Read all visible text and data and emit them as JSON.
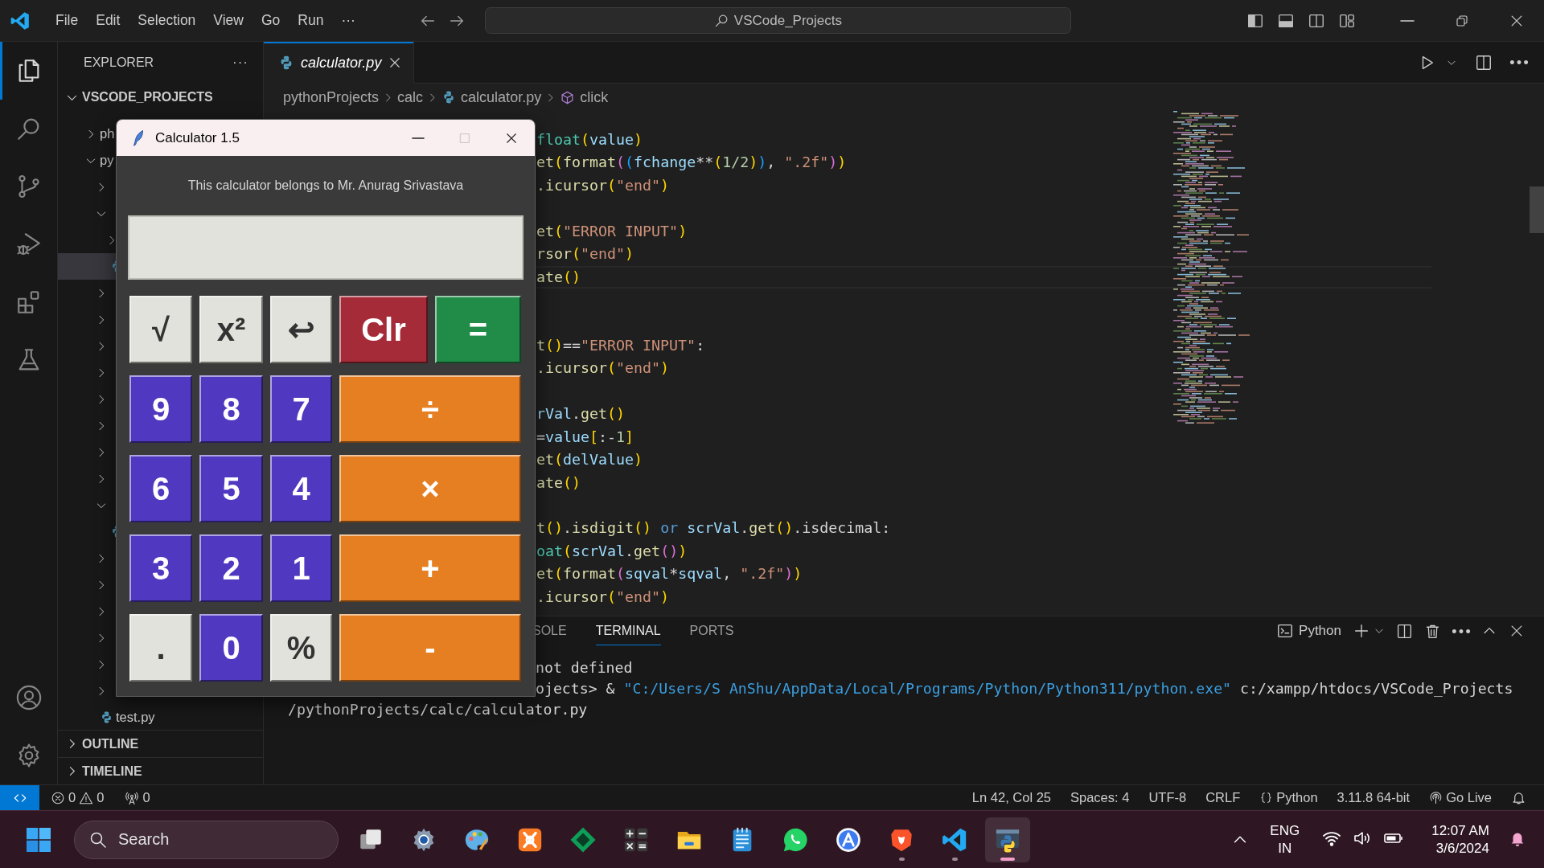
{
  "title_bar": {
    "menu": [
      "File",
      "Edit",
      "Selection",
      "View",
      "Go",
      "Run",
      "···"
    ],
    "search": "VSCode_Projects"
  },
  "explorer": {
    "title": "EXPLORER",
    "more": "···",
    "root": {
      "label": "VSCODE_PROJECTS",
      "expanded": true
    },
    "tree": [
      {
        "label": "ph",
        "kind": "folder",
        "expanded": false,
        "selected": false
      },
      {
        "label": "py",
        "kind": "folder",
        "expanded": true,
        "selected": false,
        "children": [
          {
            "kind": "folder",
            "expanded": false,
            "selected": false
          },
          {
            "kind": "folder",
            "expanded": true,
            "selected": false,
            "children": [
              {
                "kind": "folder",
                "expanded": false,
                "selected": false
              },
              {
                "kind": "file",
                "selected": true
              }
            ]
          },
          {
            "kind": "folder",
            "expanded": false,
            "selected": false
          },
          {
            "kind": "folder",
            "expanded": false,
            "selected": false
          },
          {
            "kind": "folder",
            "expanded": false,
            "selected": false
          },
          {
            "kind": "folder",
            "expanded": false,
            "selected": false
          },
          {
            "kind": "folder",
            "expanded": false,
            "selected": false
          },
          {
            "kind": "folder",
            "expanded": false,
            "selected": false
          },
          {
            "kind": "folder",
            "expanded": false,
            "selected": false
          },
          {
            "kind": "folder",
            "expanded": false,
            "selected": false
          },
          {
            "kind": "folder",
            "expanded": true,
            "selected": false,
            "children": [
              {
                "kind": "file",
                "selected": false
              }
            ]
          },
          {
            "kind": "folder",
            "expanded": false,
            "selected": false
          },
          {
            "kind": "folder",
            "expanded": false,
            "selected": false
          },
          {
            "kind": "folder",
            "expanded": false,
            "selected": false
          },
          {
            "kind": "folder",
            "expanded": false,
            "selected": false
          },
          {
            "kind": "folder",
            "expanded": false,
            "selected": false
          },
          {
            "kind": "folder",
            "expanded": false,
            "selected": false
          },
          {
            "label": "test.py",
            "kind": "file",
            "selected": false
          }
        ]
      }
    ],
    "sections": [
      {
        "label": "OUTLINE",
        "expanded": false
      },
      {
        "label": "TIMELINE",
        "expanded": false
      }
    ]
  },
  "editor": {
    "tabs": [
      {
        "label": "calculator.py",
        "selected": true
      }
    ],
    "breadcrumb": [
      {
        "label": "pythonProjects",
        "kind": "folder"
      },
      {
        "label": "calc",
        "kind": "folder"
      },
      {
        "label": "calculator.py",
        "kind": "file"
      },
      {
        "label": "click",
        "kind": "symbol"
      }
    ],
    "lines": [
      {
        "kind": "code",
        "current": false,
        "tokens": [
          {
            "text": "float",
            "kind": "builtin"
          },
          {
            "text": "(",
            "kind": "p1"
          },
          {
            "text": "value",
            "kind": "var"
          },
          {
            "text": ")",
            "kind": "p1"
          }
        ]
      },
      {
        "kind": "code",
        "current": false,
        "tokens": [
          {
            "text": "et",
            "kind": "fn"
          },
          {
            "text": "(",
            "kind": "p1"
          },
          {
            "text": "format",
            "kind": "fn"
          },
          {
            "text": "(",
            "kind": "p2"
          },
          {
            "text": "(",
            "kind": "p3"
          },
          {
            "text": "fchange",
            "kind": "var"
          },
          {
            "text": "**",
            "kind": "plain"
          },
          {
            "text": "(",
            "kind": "p1"
          },
          {
            "text": "1/2",
            "kind": "num"
          },
          {
            "text": ")",
            "kind": "p1"
          },
          {
            "text": ")",
            "kind": "p3"
          },
          {
            "text": ", ",
            "kind": "plain"
          },
          {
            "text": "\".2f\"",
            "kind": "str"
          },
          {
            "text": ")",
            "kind": "p2"
          },
          {
            "text": ")",
            "kind": "p1"
          }
        ]
      },
      {
        "kind": "code",
        "current": false,
        "tokens": [
          {
            "text": ".icursor",
            "kind": "fn"
          },
          {
            "text": "(",
            "kind": "p1"
          },
          {
            "text": "\"end\"",
            "kind": "str"
          },
          {
            "text": ")",
            "kind": "p1"
          }
        ]
      },
      {
        "kind": "blank"
      },
      {
        "kind": "code",
        "current": false,
        "tokens": [
          {
            "text": "et",
            "kind": "fn"
          },
          {
            "text": "(",
            "kind": "p1"
          },
          {
            "text": "\"ERROR INPUT\"",
            "kind": "str"
          },
          {
            "text": ")",
            "kind": "p1"
          }
        ]
      },
      {
        "kind": "code",
        "current": false,
        "tokens": [
          {
            "text": "rsor",
            "kind": "fn"
          },
          {
            "text": "(",
            "kind": "p1"
          },
          {
            "text": "\"end\"",
            "kind": "str"
          },
          {
            "text": ")",
            "kind": "p1"
          }
        ]
      },
      {
        "kind": "code",
        "current": true,
        "tokens": [
          {
            "text": "ate",
            "kind": "fn"
          },
          {
            "text": "()",
            "kind": "p1"
          }
        ]
      },
      {
        "kind": "blank"
      },
      {
        "kind": "blank"
      },
      {
        "kind": "code",
        "current": false,
        "tokens": [
          {
            "text": "t",
            "kind": "fn"
          },
          {
            "text": "()",
            "kind": "p1"
          },
          {
            "text": "==",
            "kind": "plain"
          },
          {
            "text": "\"ERROR INPUT\"",
            "kind": "str"
          },
          {
            "text": ":",
            "kind": "plain"
          }
        ]
      },
      {
        "kind": "code",
        "current": false,
        "tokens": [
          {
            "text": ".icursor",
            "kind": "fn"
          },
          {
            "text": "(",
            "kind": "p1"
          },
          {
            "text": "\"end\"",
            "kind": "str"
          },
          {
            "text": ")",
            "kind": "p1"
          }
        ]
      },
      {
        "kind": "blank"
      },
      {
        "kind": "code",
        "current": false,
        "tokens": [
          {
            "text": "rVal",
            "kind": "var"
          },
          {
            "text": ".",
            "kind": "plain"
          },
          {
            "text": "get",
            "kind": "fn"
          },
          {
            "text": "()",
            "kind": "p1"
          }
        ]
      },
      {
        "kind": "code",
        "current": false,
        "tokens": [
          {
            "text": "=",
            "kind": "plain"
          },
          {
            "text": "value",
            "kind": "var"
          },
          {
            "text": "[",
            "kind": "p1"
          },
          {
            "text": ":-",
            "kind": "plain"
          },
          {
            "text": "1",
            "kind": "num"
          },
          {
            "text": "]",
            "kind": "p1"
          }
        ]
      },
      {
        "kind": "code",
        "current": false,
        "tokens": [
          {
            "text": "et",
            "kind": "fn"
          },
          {
            "text": "(",
            "kind": "p1"
          },
          {
            "text": "delValue",
            "kind": "var"
          },
          {
            "text": ")",
            "kind": "p1"
          }
        ]
      },
      {
        "kind": "code",
        "current": false,
        "tokens": [
          {
            "text": "ate",
            "kind": "fn"
          },
          {
            "text": "()",
            "kind": "p1"
          }
        ]
      },
      {
        "kind": "blank"
      },
      {
        "kind": "code",
        "current": false,
        "tokens": [
          {
            "text": "t",
            "kind": "fn"
          },
          {
            "text": "()",
            "kind": "p1"
          },
          {
            "text": ".",
            "kind": "plain"
          },
          {
            "text": "isdigit",
            "kind": "fn"
          },
          {
            "text": "() ",
            "kind": "p1"
          },
          {
            "text": "or ",
            "kind": "kw"
          },
          {
            "text": "scrVal",
            "kind": "var"
          },
          {
            "text": ".",
            "kind": "plain"
          },
          {
            "text": "get",
            "kind": "fn"
          },
          {
            "text": "()",
            "kind": "p1"
          },
          {
            "text": ".isdecimal:",
            "kind": "plain"
          }
        ]
      },
      {
        "kind": "code",
        "current": false,
        "tokens": [
          {
            "text": "oat",
            "kind": "builtin"
          },
          {
            "text": "(",
            "kind": "p1"
          },
          {
            "text": "scrVal",
            "kind": "var"
          },
          {
            "text": ".",
            "kind": "plain"
          },
          {
            "text": "get",
            "kind": "fn"
          },
          {
            "text": "()",
            "kind": "p2"
          },
          {
            "text": ")",
            "kind": "p1"
          }
        ]
      },
      {
        "kind": "code",
        "current": false,
        "tokens": [
          {
            "text": "et",
            "kind": "fn"
          },
          {
            "text": "(",
            "kind": "p1"
          },
          {
            "text": "format",
            "kind": "fn"
          },
          {
            "text": "(",
            "kind": "p2"
          },
          {
            "text": "sqval",
            "kind": "var"
          },
          {
            "text": "*",
            "kind": "plain"
          },
          {
            "text": "sqval",
            "kind": "var"
          },
          {
            "text": ", ",
            "kind": "plain"
          },
          {
            "text": "\".2f\"",
            "kind": "str"
          },
          {
            "text": ")",
            "kind": "p2"
          },
          {
            "text": ")",
            "kind": "p1"
          }
        ]
      },
      {
        "kind": "code",
        "current": false,
        "tokens": [
          {
            "text": ".icursor",
            "kind": "fn"
          },
          {
            "text": "(",
            "kind": "p1"
          },
          {
            "text": "\"end\"",
            "kind": "str"
          },
          {
            "text": ")",
            "kind": "p1"
          }
        ]
      }
    ]
  },
  "panel": {
    "tabs": [
      {
        "label": "SOLE",
        "selected": false
      },
      {
        "label": "TERMINAL",
        "selected": true
      },
      {
        "label": "PORTS",
        "selected": false
      }
    ],
    "terminal_name": "Python",
    "lines": [
      {
        "kind": "clipped",
        "tokens": [
          {
            "text": "not defined",
            "kind": "plain"
          }
        ]
      },
      {
        "kind": "clipped",
        "tokens": [
          {
            "text": "ojects> & ",
            "kind": "plain"
          },
          {
            "text": "\"C:/Users/S AnShu/AppData/Local/Programs/Python/Python311/python.exe\"",
            "kind": "path"
          },
          {
            "text": " c:/xampp/htdocs/VSCode_Projects",
            "kind": "plain"
          }
        ]
      },
      {
        "kind": "full",
        "tokens": [
          {
            "text": "/pythonProjects/calc/calculator.py",
            "kind": "plain"
          }
        ]
      }
    ]
  },
  "status_bar": {
    "errors": "0",
    "warnings": "0",
    "ports": "0",
    "items": [
      {
        "text": "Ln 42, Col 25",
        "kind": "text"
      },
      {
        "text": "Spaces: 4",
        "kind": "text"
      },
      {
        "text": "UTF-8",
        "kind": "text"
      },
      {
        "text": "CRLF",
        "kind": "text"
      },
      {
        "text": "Python",
        "kind": "language"
      },
      {
        "text": "3.11.8 64-bit",
        "kind": "text"
      },
      {
        "text": "Go Live",
        "kind": "live"
      }
    ]
  },
  "calculator": {
    "title": "Calculator 1.5",
    "caption": "This calculator belongs to Mr. Anurag Srivastava",
    "buttons": [
      {
        "label": "√",
        "kind": "light"
      },
      {
        "label": "x²",
        "kind": "light"
      },
      {
        "label": "↩",
        "kind": "light"
      },
      {
        "label": "Clr",
        "kind": "clear"
      },
      {
        "label": "=",
        "kind": "equals"
      },
      {
        "label": "9",
        "kind": "digit"
      },
      {
        "label": "8",
        "kind": "digit"
      },
      {
        "label": "7",
        "kind": "digit"
      },
      {
        "label": "÷",
        "kind": "op"
      },
      {
        "label": "6",
        "kind": "digit"
      },
      {
        "label": "5",
        "kind": "digit"
      },
      {
        "label": "4",
        "kind": "digit"
      },
      {
        "label": "×",
        "kind": "op"
      },
      {
        "label": "3",
        "kind": "digit"
      },
      {
        "label": "2",
        "kind": "digit"
      },
      {
        "label": "1",
        "kind": "digit"
      },
      {
        "label": "+",
        "kind": "op"
      },
      {
        "label": ".",
        "kind": "light"
      },
      {
        "label": "0",
        "kind": "digit"
      },
      {
        "label": "%",
        "kind": "light"
      },
      {
        "label": "-",
        "kind": "op"
      }
    ]
  },
  "taskbar": {
    "search_placeholder": "Search",
    "apps": [
      {
        "kind": "task-view",
        "running": false,
        "active": false
      },
      {
        "kind": "settings",
        "running": false,
        "active": false
      },
      {
        "kind": "paint",
        "running": false,
        "active": false
      },
      {
        "kind": "xampp",
        "running": false,
        "active": false
      },
      {
        "kind": "diamond",
        "running": false,
        "active": false
      },
      {
        "kind": "calculator",
        "running": false,
        "active": false
      },
      {
        "kind": "folder",
        "running": false,
        "active": false
      },
      {
        "kind": "notepad",
        "running": false,
        "active": false
      },
      {
        "kind": "whatsapp",
        "running": false,
        "active": false
      },
      {
        "kind": "peak",
        "running": false,
        "active": false
      },
      {
        "kind": "brave",
        "running": true,
        "active": false
      },
      {
        "kind": "vscode",
        "running": true,
        "active": false
      },
      {
        "kind": "python-app",
        "running": true,
        "active": true
      }
    ],
    "language": "ENG",
    "region": "IN",
    "time": "12:07 AM",
    "date": "3/6/2024"
  }
}
